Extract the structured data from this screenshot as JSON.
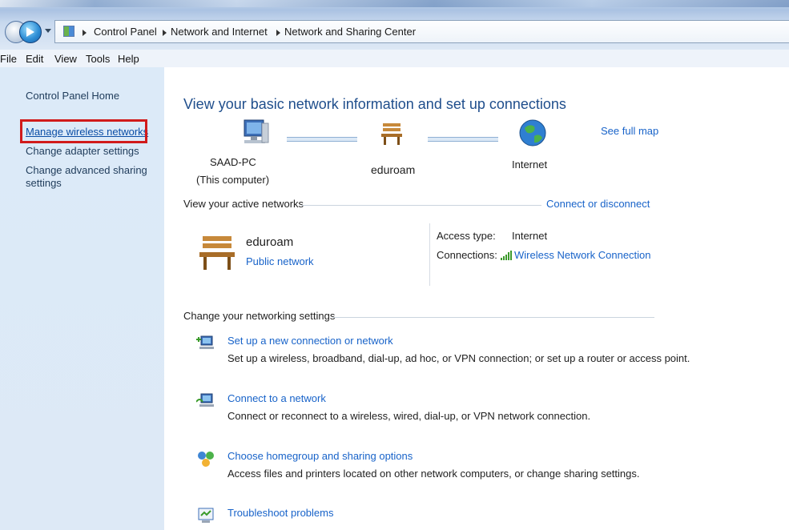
{
  "breadcrumb": {
    "items": [
      "Control Panel",
      "Network and Internet",
      "Network and Sharing Center"
    ]
  },
  "menu": [
    "File",
    "Edit",
    "View",
    "Tools",
    "Help"
  ],
  "sidebar": {
    "home": "Control Panel Home",
    "items": [
      "Manage wireless networks",
      "Change adapter settings",
      "Change advanced sharing",
      "settings"
    ]
  },
  "main": {
    "title": "View your basic network information and set up connections",
    "see_full_map": "See full map",
    "map": {
      "computer_name": "SAAD-PC",
      "computer_sub": "(This computer)",
      "network_name": "eduroam",
      "internet": "Internet"
    },
    "active_networks": {
      "heading": "View your active networks",
      "connect_link": "Connect or disconnect",
      "network_name": "eduroam",
      "network_type": "Public network",
      "access_type_label": "Access type:",
      "access_type_value": "Internet",
      "connections_label": "Connections:",
      "connections_value": "Wireless Network Connection"
    },
    "change_settings": {
      "heading": "Change your networking settings",
      "tasks": [
        {
          "title": "Set up a new connection or network",
          "desc": "Set up a wireless, broadband, dial-up, ad hoc, or VPN connection; or set up a router or access point."
        },
        {
          "title": "Connect to a network",
          "desc": "Connect or reconnect to a wireless, wired, dial-up, or VPN network connection."
        },
        {
          "title": "Choose homegroup and sharing options",
          "desc": "Access files and printers located on other network computers, or change sharing settings."
        },
        {
          "title": "Troubleshoot problems"
        }
      ]
    }
  }
}
